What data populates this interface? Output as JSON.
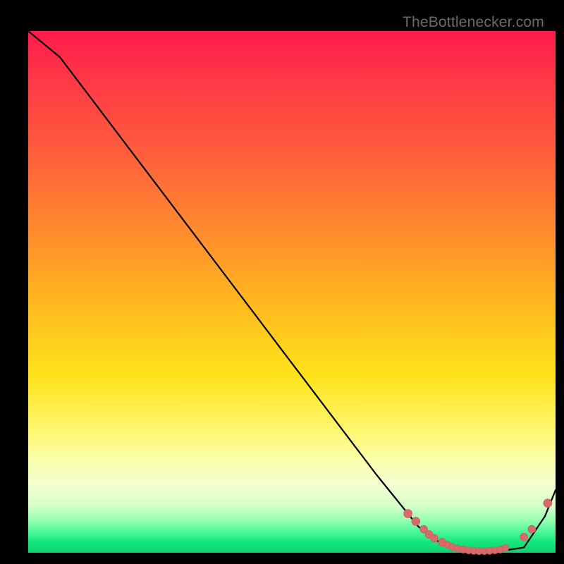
{
  "watermark": "TheBottlenecker.com",
  "colors": {
    "curve_stroke": "#000000",
    "marker_fill": "#d86a6a",
    "marker_stroke": "#c95a5a"
  },
  "chart_data": {
    "type": "line",
    "title": "",
    "xlabel": "",
    "ylabel": "",
    "xlim": [
      0,
      100
    ],
    "ylim": [
      0,
      100
    ],
    "x": [
      0,
      6,
      12,
      18,
      24,
      30,
      36,
      42,
      48,
      54,
      60,
      66,
      70,
      74,
      78,
      82,
      86,
      90,
      94,
      98,
      100
    ],
    "y": [
      100,
      95,
      87,
      79,
      71,
      63,
      55,
      47,
      39,
      31,
      23,
      15,
      10,
      5,
      2,
      0.6,
      0.3,
      0.4,
      1,
      7,
      12
    ],
    "markers": {
      "x": [
        72,
        73.5,
        75,
        76,
        77,
        78.5,
        79.5,
        80.5,
        81.5,
        82.5,
        83.5,
        84.5,
        85.5,
        86.5,
        87.5,
        88.5,
        89.5,
        90.5,
        94,
        95.5,
        98.5
      ],
      "y": [
        7.5,
        6.0,
        4.5,
        3.5,
        2.8,
        2.0,
        1.5,
        1.1,
        0.8,
        0.6,
        0.45,
        0.35,
        0.3,
        0.3,
        0.35,
        0.45,
        0.6,
        0.9,
        3.0,
        4.5,
        9.5
      ],
      "size": [
        6,
        6,
        5.5,
        5.5,
        5.5,
        5.5,
        5,
        5,
        5,
        5,
        5,
        5,
        5,
        5,
        5,
        5,
        5,
        5,
        5.5,
        5.5,
        6
      ]
    }
  }
}
